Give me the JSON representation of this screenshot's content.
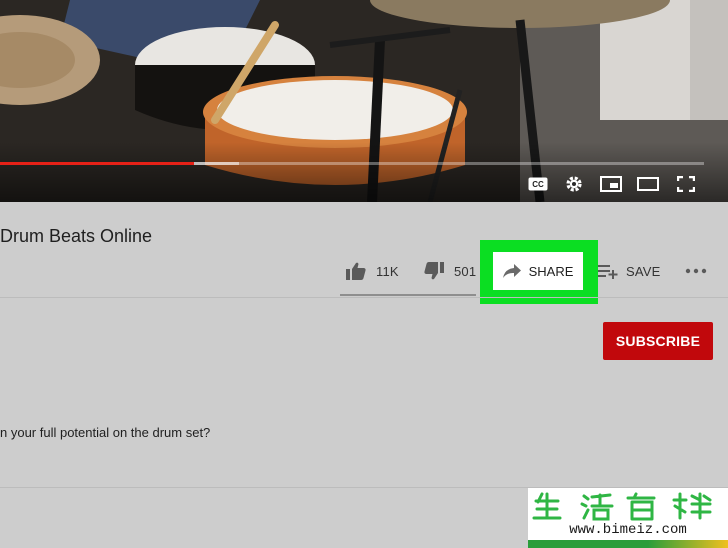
{
  "video": {
    "progress_played_fraction": 0.275,
    "progress_buffered_fraction": 0.34,
    "controls": [
      {
        "name": "closed-captions-icon"
      },
      {
        "name": "settings-gear-icon"
      },
      {
        "name": "miniplayer-icon"
      },
      {
        "name": "theater-mode-icon"
      },
      {
        "name": "fullscreen-icon"
      }
    ]
  },
  "title": "Drum Beats Online",
  "actions": {
    "like_count": "11K",
    "dislike_count": "501",
    "share_label": "SHARE",
    "save_label": "SAVE"
  },
  "channel": {
    "subscribe_label": "SUBSCRIBE"
  },
  "description": {
    "text": "n your full potential on the drum set?"
  },
  "watermark": {
    "url": "www.bimeiz.com"
  },
  "colors": {
    "progress_red": "#e62117",
    "subscribe_red": "#c1080c",
    "highlight_green": "#0bde22"
  }
}
